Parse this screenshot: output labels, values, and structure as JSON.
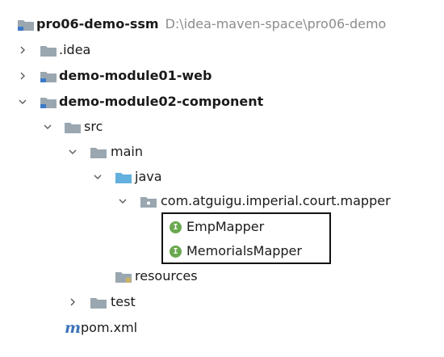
{
  "project": {
    "name": "pro06-demo-ssm",
    "path": "D:\\idea-maven-space\\pro06-demo"
  },
  "tree": {
    "idea": ".idea",
    "web_module": "demo-module01-web",
    "component_module": "demo-module02-component",
    "src": "src",
    "main": "main",
    "java": "java",
    "package": "com.atguigu.imperial.court.mapper",
    "emp_mapper": "EmpMapper",
    "memorials_mapper": "MemorialsMapper",
    "resources": "resources",
    "test": "test",
    "pom": "pom.xml"
  },
  "icons": {
    "interface_letter": "I",
    "maven_letter": "m"
  },
  "colors": {
    "folder": "#9aa7b0",
    "source_folder": "#62b0dd",
    "module_marker": "#3a7ac9",
    "interface_icon": "#6aa84f",
    "path_text": "#8c8c8c"
  }
}
